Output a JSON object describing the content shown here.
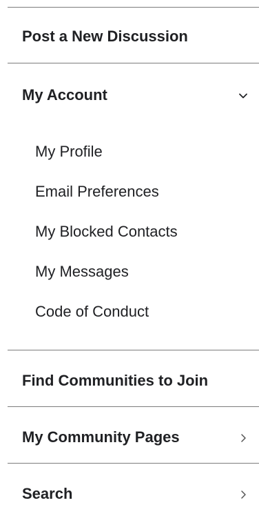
{
  "menu": {
    "post_discussion": "Post a New Discussion",
    "my_account": {
      "label": "My Account",
      "chevron_icon": "chevron-down",
      "expanded": true,
      "items": [
        "My Profile",
        "Email Preferences",
        "My Blocked Contacts",
        "My Messages",
        "Code of Conduct"
      ]
    },
    "find_communities": "Find Communities to Join",
    "my_community_pages": {
      "label": "My Community Pages",
      "chevron_icon": "chevron-right"
    },
    "search": {
      "label": "Search",
      "chevron_icon": "chevron-right"
    }
  },
  "colors": {
    "text": "#202124",
    "divider": "#7b7b7b",
    "chevron": "#555555",
    "background": "#ffffff"
  }
}
